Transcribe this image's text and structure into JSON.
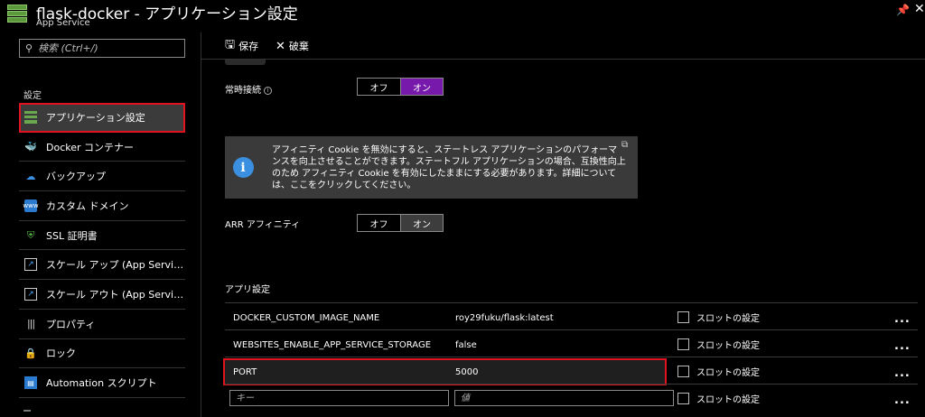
{
  "header": {
    "title": "flask-docker - アプリケーション設定",
    "subtitle": "App Service",
    "pin_icon": "pin-icon",
    "close_icon": "close-icon"
  },
  "sidebar": {
    "search_placeholder": "検索 (Ctrl+/)",
    "section_label": "設定",
    "items": [
      {
        "label": "アプリケーション設定",
        "icon": "app-settings-icon",
        "active": true
      },
      {
        "label": "Docker コンテナー",
        "icon": "docker-icon"
      },
      {
        "label": "バックアップ",
        "icon": "backup-icon"
      },
      {
        "label": "カスタム ドメイン",
        "icon": "custom-domain-icon"
      },
      {
        "label": "SSL 証明書",
        "icon": "ssl-shield-icon"
      },
      {
        "label": "スケール アップ (App Service ...",
        "icon": "scale-up-icon"
      },
      {
        "label": "スケール アウト (App Service ...",
        "icon": "scale-out-icon"
      },
      {
        "label": "プロパティ",
        "icon": "properties-icon"
      },
      {
        "label": "ロック",
        "icon": "lock-icon"
      },
      {
        "label": "Automation スクリプト",
        "icon": "automation-icon"
      }
    ]
  },
  "toolbar": {
    "save_label": "保存",
    "discard_label": "破棄"
  },
  "always_on": {
    "label": "常時接続",
    "off_label": "オフ",
    "on_label": "オン",
    "value": "on"
  },
  "info_box": {
    "text": "アフィニティ Cookie を無効にすると、ステートレス アプリケーションのパフォーマンスを向上させることができます。ステートフル アプリケーションの場合、互換性向上のため アフィニティ Cookie を有効にしたままにする必要があります。詳細については、ここをクリックしてください。"
  },
  "arr_affinity": {
    "label": "ARR アフィニティ",
    "off_label": "オフ",
    "on_label": "オン",
    "value": "on"
  },
  "app_settings": {
    "title": "アプリ設定",
    "slot_label": "スロットの設定",
    "more_label": "...",
    "rows": [
      {
        "name": "DOCKER_CUSTOM_IMAGE_NAME",
        "value": "roy29fuku/flask:latest"
      },
      {
        "name": "WEBSITES_ENABLE_APP_SERVICE_STORAGE",
        "value": "false"
      },
      {
        "name": "PORT",
        "value": "5000"
      }
    ],
    "new_key_placeholder": "キー",
    "new_value_placeholder": "値"
  },
  "colors": {
    "accent_purple": "#7719aa",
    "highlight_red": "#e0141e",
    "info_blue": "#3b8fe0"
  }
}
